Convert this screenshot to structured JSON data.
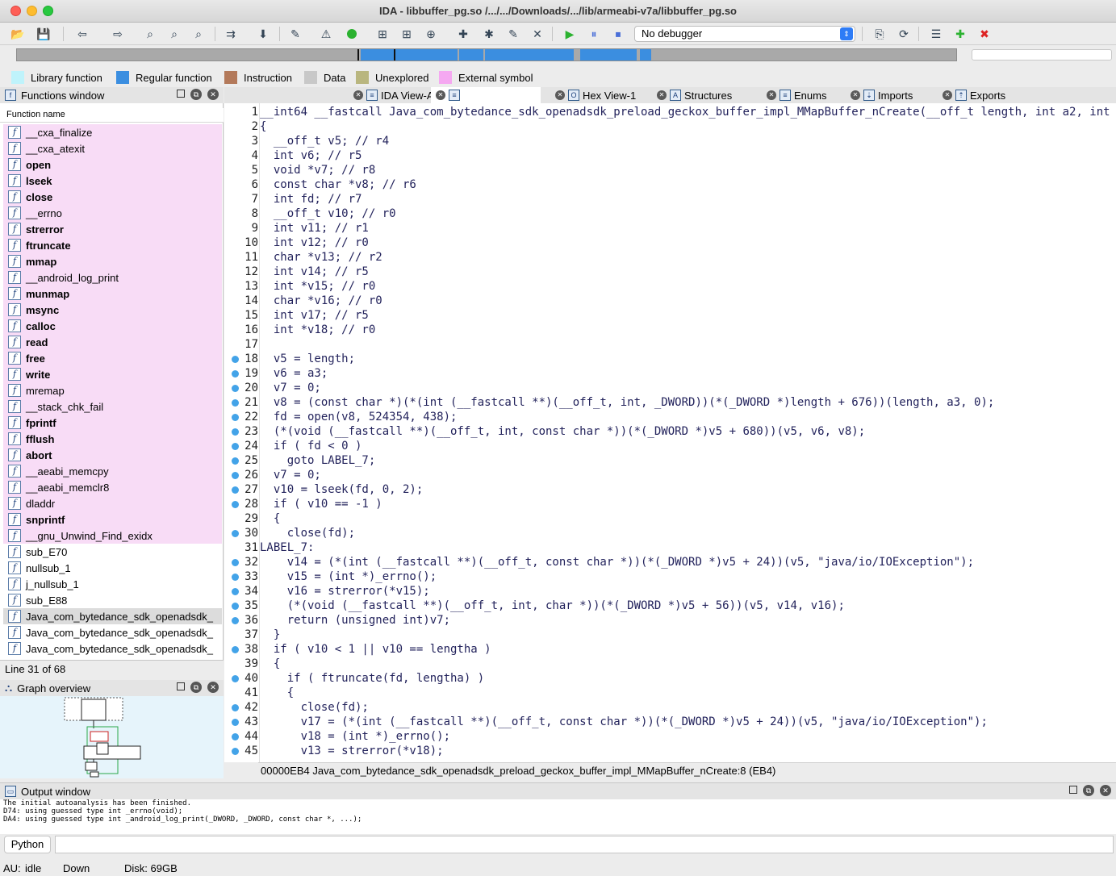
{
  "window": {
    "title": "IDA - libbuffer_pg.so /.../.../Downloads/.../lib/armeabi-v7a/libbuffer_pg.so"
  },
  "toolbar": {
    "debugger_select": "No debugger"
  },
  "legend": [
    {
      "label": "Library function",
      "color": "#bff3fb"
    },
    {
      "label": "Regular function",
      "color": "#3b8ee0"
    },
    {
      "label": "Instruction",
      "color": "#b3795a"
    },
    {
      "label": "Data",
      "color": "#c8c8c8"
    },
    {
      "label": "Unexplored",
      "color": "#b9b67f"
    },
    {
      "label": "External symbol",
      "color": "#f5a8f1"
    }
  ],
  "functions_window": {
    "title": "Functions window",
    "column_header": "Function name",
    "items": [
      {
        "name": "__cxa_finalize",
        "kind": "lib",
        "bold": false
      },
      {
        "name": "__cxa_atexit",
        "kind": "lib",
        "bold": false
      },
      {
        "name": "open",
        "kind": "lib",
        "bold": true
      },
      {
        "name": "lseek",
        "kind": "lib",
        "bold": true
      },
      {
        "name": "close",
        "kind": "lib",
        "bold": true
      },
      {
        "name": "__errno",
        "kind": "lib",
        "bold": false
      },
      {
        "name": "strerror",
        "kind": "lib",
        "bold": true
      },
      {
        "name": "ftruncate",
        "kind": "lib",
        "bold": true
      },
      {
        "name": "mmap",
        "kind": "lib",
        "bold": true
      },
      {
        "name": "__android_log_print",
        "kind": "lib",
        "bold": false
      },
      {
        "name": "munmap",
        "kind": "lib",
        "bold": true
      },
      {
        "name": "msync",
        "kind": "lib",
        "bold": true
      },
      {
        "name": "calloc",
        "kind": "lib",
        "bold": true
      },
      {
        "name": "read",
        "kind": "lib",
        "bold": true
      },
      {
        "name": "free",
        "kind": "lib",
        "bold": true
      },
      {
        "name": "write",
        "kind": "lib",
        "bold": true
      },
      {
        "name": "mremap",
        "kind": "lib",
        "bold": false
      },
      {
        "name": "__stack_chk_fail",
        "kind": "lib",
        "bold": false
      },
      {
        "name": "fprintf",
        "kind": "lib",
        "bold": true
      },
      {
        "name": "fflush",
        "kind": "lib",
        "bold": true
      },
      {
        "name": "abort",
        "kind": "lib",
        "bold": true
      },
      {
        "name": "__aeabi_memcpy",
        "kind": "lib",
        "bold": false
      },
      {
        "name": "__aeabi_memclr8",
        "kind": "lib",
        "bold": false
      },
      {
        "name": "dladdr",
        "kind": "lib",
        "bold": false
      },
      {
        "name": "snprintf",
        "kind": "lib",
        "bold": true
      },
      {
        "name": "__gnu_Unwind_Find_exidx",
        "kind": "lib",
        "bold": false
      },
      {
        "name": "sub_E70",
        "kind": "reg",
        "bold": false
      },
      {
        "name": "nullsub_1",
        "kind": "reg",
        "bold": false
      },
      {
        "name": "j_nullsub_1",
        "kind": "reg",
        "bold": false
      },
      {
        "name": "sub_E88",
        "kind": "reg",
        "bold": false
      },
      {
        "name": "Java_com_bytedance_sdk_openadsdk_",
        "kind": "sel",
        "bold": false
      },
      {
        "name": "Java_com_bytedance_sdk_openadsdk_",
        "kind": "reg",
        "bold": false
      },
      {
        "name": "Java_com_bytedance_sdk_openadsdk_",
        "kind": "reg",
        "bold": false
      }
    ],
    "line_status": "Line 31 of 68"
  },
  "graph_overview": {
    "title": "Graph overview"
  },
  "tabs": [
    {
      "label": "IDA View-A"
    },
    {
      "label": ""
    },
    {
      "label": "Hex View-1"
    },
    {
      "label": "Structures"
    },
    {
      "label": "Enums"
    },
    {
      "label": "Imports"
    },
    {
      "label": "Exports"
    }
  ],
  "pseudocode": [
    {
      "n": "1",
      "bp": false,
      "code": "__int64 __fastcall Java_com_bytedance_sdk_openadsdk_preload_geckox_buffer_impl_MMapBuffer_nCreate(__off_t length, int a2, int a"
    },
    {
      "n": "2",
      "bp": false,
      "code": "{"
    },
    {
      "n": "3",
      "bp": false,
      "code": "  __off_t v5; // r4"
    },
    {
      "n": "4",
      "bp": false,
      "code": "  int v6; // r5"
    },
    {
      "n": "5",
      "bp": false,
      "code": "  void *v7; // r8"
    },
    {
      "n": "6",
      "bp": false,
      "code": "  const char *v8; // r6"
    },
    {
      "n": "7",
      "bp": false,
      "code": "  int fd; // r7"
    },
    {
      "n": "8",
      "bp": false,
      "code": "  __off_t v10; // r0"
    },
    {
      "n": "9",
      "bp": false,
      "code": "  int v11; // r1"
    },
    {
      "n": "10",
      "bp": false,
      "code": "  int v12; // r0"
    },
    {
      "n": "11",
      "bp": false,
      "code": "  char *v13; // r2"
    },
    {
      "n": "12",
      "bp": false,
      "code": "  int v14; // r5"
    },
    {
      "n": "13",
      "bp": false,
      "code": "  int *v15; // r0"
    },
    {
      "n": "14",
      "bp": false,
      "code": "  char *v16; // r0"
    },
    {
      "n": "15",
      "bp": false,
      "code": "  int v17; // r5"
    },
    {
      "n": "16",
      "bp": false,
      "code": "  int *v18; // r0"
    },
    {
      "n": "17",
      "bp": false,
      "code": ""
    },
    {
      "n": "18",
      "bp": true,
      "code": "  v5 = length;"
    },
    {
      "n": "19",
      "bp": true,
      "code": "  v6 = a3;"
    },
    {
      "n": "20",
      "bp": true,
      "code": "  v7 = 0;"
    },
    {
      "n": "21",
      "bp": true,
      "code": "  v8 = (const char *)(*(int (__fastcall **)(__off_t, int, _DWORD))(*(_DWORD *)length + 676))(length, a3, 0);"
    },
    {
      "n": "22",
      "bp": true,
      "code": "  fd = open(v8, 524354, 438);"
    },
    {
      "n": "23",
      "bp": true,
      "code": "  (*(void (__fastcall **)(__off_t, int, const char *))(*(_DWORD *)v5 + 680))(v5, v6, v8);"
    },
    {
      "n": "24",
      "bp": true,
      "code": "  if ( fd < 0 )"
    },
    {
      "n": "25",
      "bp": true,
      "code": "    goto LABEL_7;"
    },
    {
      "n": "26",
      "bp": true,
      "code": "  v7 = 0;"
    },
    {
      "n": "27",
      "bp": true,
      "code": "  v10 = lseek(fd, 0, 2);"
    },
    {
      "n": "28",
      "bp": true,
      "code": "  if ( v10 == -1 )"
    },
    {
      "n": "29",
      "bp": false,
      "code": "  {"
    },
    {
      "n": "30",
      "bp": true,
      "code": "    close(fd);"
    },
    {
      "n": "31",
      "bp": false,
      "code": "LABEL_7:"
    },
    {
      "n": "32",
      "bp": true,
      "code": "    v14 = (*(int (__fastcall **)(__off_t, const char *))(*(_DWORD *)v5 + 24))(v5, \"java/io/IOException\");"
    },
    {
      "n": "33",
      "bp": true,
      "code": "    v15 = (int *)_errno();"
    },
    {
      "n": "34",
      "bp": true,
      "code": "    v16 = strerror(*v15);"
    },
    {
      "n": "35",
      "bp": true,
      "code": "    (*(void (__fastcall **)(__off_t, int, char *))(*(_DWORD *)v5 + 56))(v5, v14, v16);"
    },
    {
      "n": "36",
      "bp": true,
      "code": "    return (unsigned int)v7;"
    },
    {
      "n": "37",
      "bp": false,
      "code": "  }"
    },
    {
      "n": "38",
      "bp": true,
      "code": "  if ( v10 < 1 || v10 == lengtha )"
    },
    {
      "n": "39",
      "bp": false,
      "code": "  {"
    },
    {
      "n": "40",
      "bp": true,
      "code": "    if ( ftruncate(fd, lengtha) )"
    },
    {
      "n": "41",
      "bp": false,
      "code": "    {"
    },
    {
      "n": "42",
      "bp": true,
      "code": "      close(fd);"
    },
    {
      "n": "43",
      "bp": true,
      "code": "      v17 = (*(int (__fastcall **)(__off_t, const char *))(*(_DWORD *)v5 + 24))(v5, \"java/io/IOException\");"
    },
    {
      "n": "44",
      "bp": true,
      "code": "      v18 = (int *)_errno();"
    },
    {
      "n": "45",
      "bp": true,
      "code": "      v13 = strerror(*v18);"
    }
  ],
  "address_bar": "00000EB4 Java_com_bytedance_sdk_openadsdk_preload_geckox_buffer_impl_MMapBuffer_nCreate:8 (EB4)",
  "output_window": {
    "title": "Output window",
    "lines": [
      "The initial autoanalysis has been finished.",
      "D74: using guessed type int _errno(void);",
      "DA4: using guessed type int _android_log_print(_DWORD, _DWORD, const char *, ...);"
    ]
  },
  "python": {
    "label": "Python"
  },
  "status": {
    "au": "AU:",
    "au_state": "idle",
    "direction": "Down",
    "disk": "Disk: 69GB"
  }
}
